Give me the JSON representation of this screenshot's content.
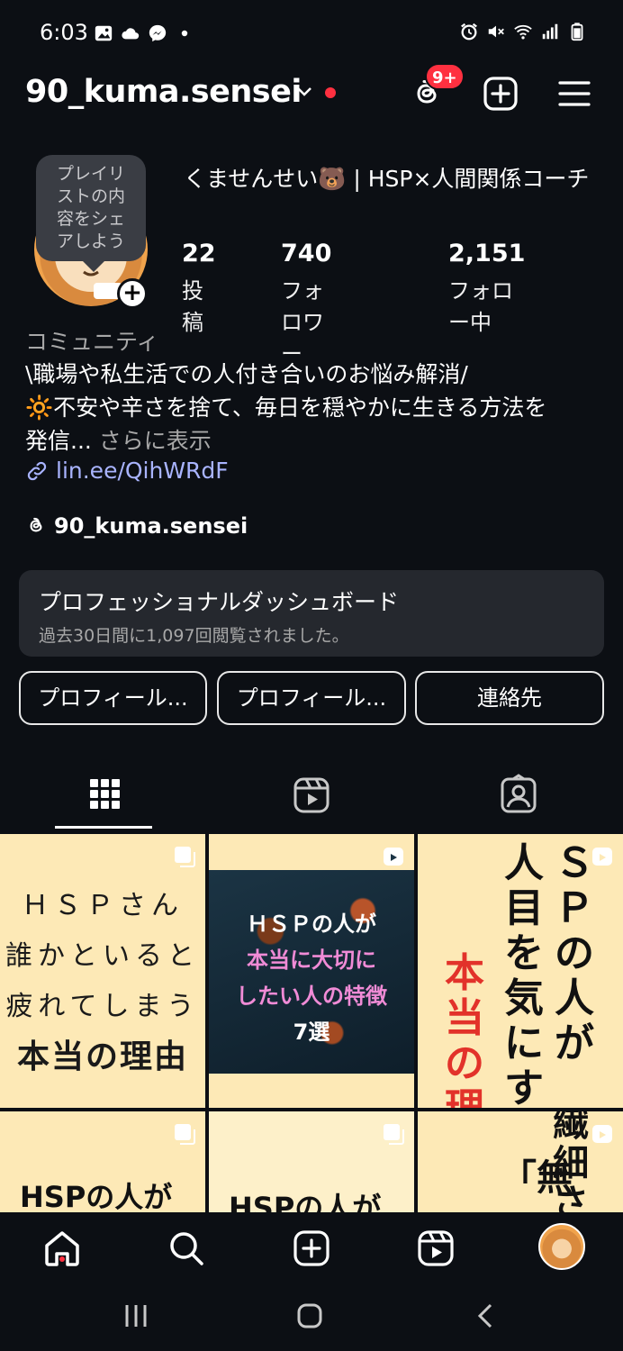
{
  "status_bar": {
    "time": "6:03",
    "left_icons": [
      "gallery-icon",
      "cloud-icon",
      "messenger-icon",
      "dot-icon"
    ],
    "right_icons": [
      "alarm-icon",
      "mute-icon",
      "wifi-icon",
      "signal-icon",
      "battery-icon"
    ]
  },
  "header": {
    "username": "90_kuma.sensei",
    "threads_badge": "9+",
    "icons": [
      "threads-icon",
      "create-icon",
      "menu-icon"
    ]
  },
  "profile": {
    "note_bubble": "プレイリストの内容をシェアしよう",
    "note_lines": [
      "プレイリ",
      "ストの内",
      "容をシェ",
      "アしよう"
    ],
    "full_name": "くませんせい🐻 | HSP×人間関係コーチ",
    "stats": [
      {
        "value": "22",
        "label": "投稿"
      },
      {
        "value": "740",
        "label": "フォロワー"
      },
      {
        "value": "2,151",
        "label": "フォロー中"
      }
    ],
    "category": "コミュニティ",
    "bio_line1": "\\職場や私生活での人付き合いのお悩み解消/",
    "bio_line2": "🔆不安や辛さを捨て、毎日を穏やかに生きる方法を",
    "bio_line3": "発信...",
    "bio_more": "さらに表示",
    "link": "lin.ee/QihWRdF",
    "threads_handle": "90_kuma.sensei"
  },
  "dashboard": {
    "title": "プロフェッショナルダッシュボード",
    "subtitle": "過去30日間に1,097回閲覧されました。"
  },
  "buttons": {
    "edit_profile": "プロフィール...",
    "share_profile": "プロフィール...",
    "contact": "連絡先"
  },
  "tabs": [
    "grid-tab",
    "reels-tab",
    "tagged-tab"
  ],
  "posts": [
    {
      "lines": [
        "ＨＳＰさん",
        "誰かといると",
        "疲れてしまう",
        "本当の理由"
      ]
    },
    {
      "lines": [
        "ＨＳＰの人が",
        "本当に大切に",
        "したい人の特徴",
        "7選"
      ]
    },
    {
      "lines": [
        "ＳＰの人が",
        "人目を気にする",
        "本当の理"
      ]
    },
    {
      "lines": [
        "HSPの人が"
      ]
    },
    {
      "lines": [
        "HSPの人が"
      ]
    },
    {
      "lines": [
        "繊細さん",
        "「無"
      ]
    }
  ],
  "colors": {
    "background": "#0c0f14",
    "link": "#a9b4ff",
    "notification": "#ff3040",
    "post_cream": "#fde9b6"
  }
}
